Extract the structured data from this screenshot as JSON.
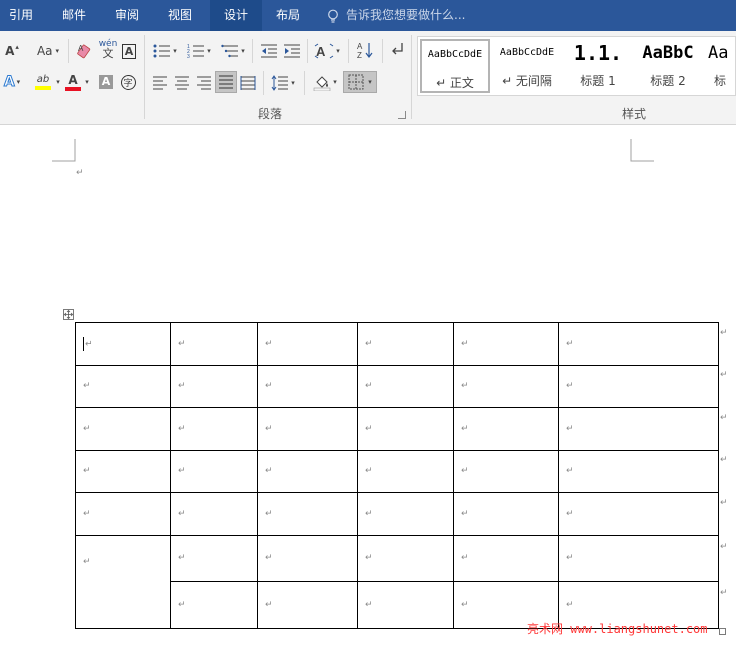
{
  "tabs": [
    "引用",
    "邮件",
    "审阅",
    "视图",
    "设计",
    "布局"
  ],
  "active_tab": "设计",
  "tell_me": {
    "placeholder": "告诉我您想要做什么..."
  },
  "ribbon": {
    "font_group": {
      "grow_font_glyph": "A",
      "change_case_glyph": "Aa",
      "phonetic_guide_glyph": "wén",
      "enclose_char_glyph": "A",
      "text_effects_glyph": "A",
      "highlight_glyph": "ab",
      "font_color_glyph": "A",
      "char_shading_glyph": "A",
      "enclosed_glyph": "字",
      "font_color_hex": "#e81123",
      "highlight_hex": "#ffff00"
    },
    "paragraph_group": {
      "label": "段落"
    },
    "styles_group": {
      "label": "样式",
      "items": [
        {
          "sample": "AaBbCcDdE",
          "name": "↵ 正文",
          "selected": true
        },
        {
          "sample": "AaBbCcDdE",
          "name": "↵ 无间隔",
          "selected": false
        },
        {
          "sample": "1.1.",
          "name": "标题 1",
          "selected": false
        },
        {
          "sample": "AaBbC",
          "name": "标题 2",
          "selected": false
        },
        {
          "sample": "Aa",
          "name": "标",
          "selected": false
        }
      ]
    }
  },
  "document": {
    "paragraph_mark": "↵",
    "table": {
      "rows": [
        [
          "↵",
          "↵",
          "↵",
          "↵",
          "↵",
          "↵"
        ],
        [
          "↵",
          "↵",
          "↵",
          "↵",
          "↵",
          "↵"
        ],
        [
          "↵",
          "↵",
          "↵",
          "↵",
          "↵",
          "↵"
        ],
        [
          "↵",
          "↵",
          "↵",
          "↵",
          "↵",
          "↵"
        ],
        [
          "↵",
          "↵",
          "↵",
          "↵",
          "↵",
          "↵"
        ],
        [
          "↵",
          "↵",
          "↵",
          "↵",
          "↵",
          "↵"
        ],
        [
          "↵",
          "↵",
          "↵",
          "↵",
          "↵"
        ]
      ],
      "row_end_mark": "↵"
    }
  },
  "watermark": "亮术网 www.liangshunet.com"
}
